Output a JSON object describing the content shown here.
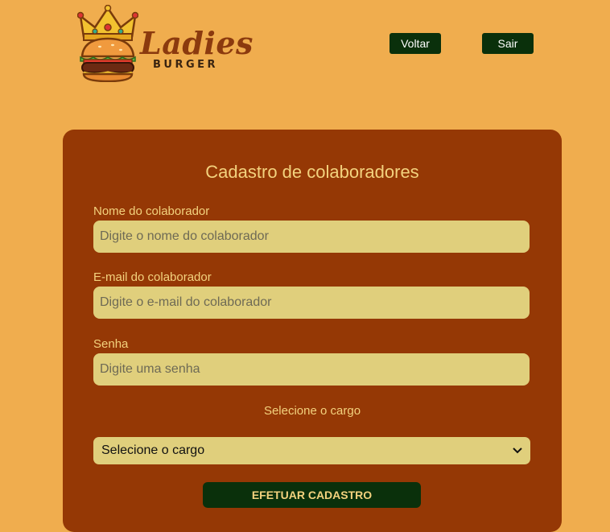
{
  "logo": {
    "title": "Ladies",
    "subtitle": "BURGER",
    "icon": "burger-crown-icon"
  },
  "nav": {
    "back_label": "Voltar",
    "exit_label": "Sair"
  },
  "form": {
    "title": "Cadastro de colaboradores",
    "name": {
      "label": "Nome do colaborador",
      "placeholder": "Digite o nome do colaborador",
      "value": ""
    },
    "email": {
      "label": "E-mail do colaborador",
      "placeholder": "Digite o e-mail do colaborador",
      "value": ""
    },
    "password": {
      "label": "Senha",
      "placeholder": "Digite uma senha",
      "value": ""
    },
    "role": {
      "label": "Selecione o cargo",
      "selected": "Selecione o cargo"
    },
    "submit_label": "EFETUAR CADASTRO"
  },
  "colors": {
    "background": "#F0AD4E",
    "card": "#953805",
    "input": "#E0CF7C",
    "button": "#0A300B",
    "text_accent": "#F3D27E"
  }
}
